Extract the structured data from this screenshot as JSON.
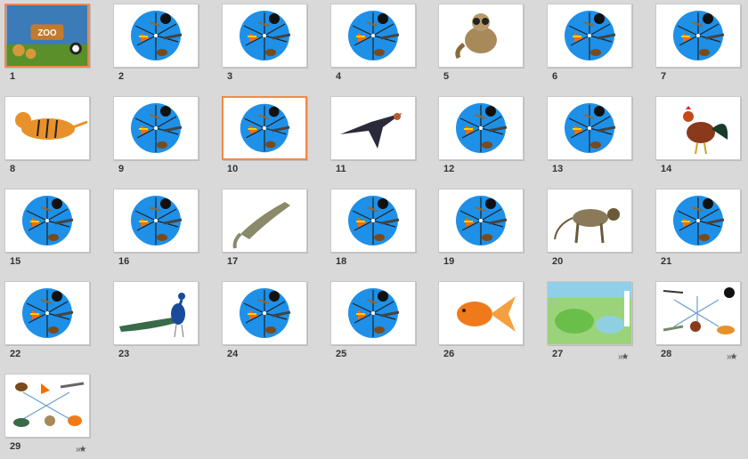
{
  "slides": [
    {
      "number": "1",
      "thumb": "zoo-title",
      "selected": true
    },
    {
      "number": "2",
      "thumb": "wheel"
    },
    {
      "number": "3",
      "thumb": "wheel"
    },
    {
      "number": "4",
      "thumb": "wheel"
    },
    {
      "number": "5",
      "thumb": "lemur"
    },
    {
      "number": "6",
      "thumb": "wheel"
    },
    {
      "number": "7",
      "thumb": "wheel"
    },
    {
      "number": "8",
      "thumb": "tiger"
    },
    {
      "number": "9",
      "thumb": "wheel"
    },
    {
      "number": "10",
      "thumb": "wheel",
      "current": true
    },
    {
      "number": "11",
      "thumb": "swallow"
    },
    {
      "number": "12",
      "thumb": "wheel"
    },
    {
      "number": "13",
      "thumb": "wheel"
    },
    {
      "number": "14",
      "thumb": "rooster"
    },
    {
      "number": "15",
      "thumb": "wheel"
    },
    {
      "number": "16",
      "thumb": "wheel"
    },
    {
      "number": "17",
      "thumb": "crocodile"
    },
    {
      "number": "18",
      "thumb": "wheel"
    },
    {
      "number": "19",
      "thumb": "wheel"
    },
    {
      "number": "20",
      "thumb": "monkey"
    },
    {
      "number": "21",
      "thumb": "wheel"
    },
    {
      "number": "22",
      "thumb": "wheel"
    },
    {
      "number": "23",
      "thumb": "peacock"
    },
    {
      "number": "24",
      "thumb": "wheel"
    },
    {
      "number": "25",
      "thumb": "wheel"
    },
    {
      "number": "26",
      "thumb": "goldfish"
    },
    {
      "number": "27",
      "thumb": "map-scene",
      "animation": true
    },
    {
      "number": "28",
      "thumb": "matching-animals",
      "animation": true
    },
    {
      "number": "29",
      "thumb": "matching-mixed",
      "animation": true
    }
  ],
  "colors": {
    "selection_border": "#f08a4b",
    "wheel_blue": "#1e90e8",
    "background": "#d9d9d9"
  },
  "animation_icon": "star-icon"
}
